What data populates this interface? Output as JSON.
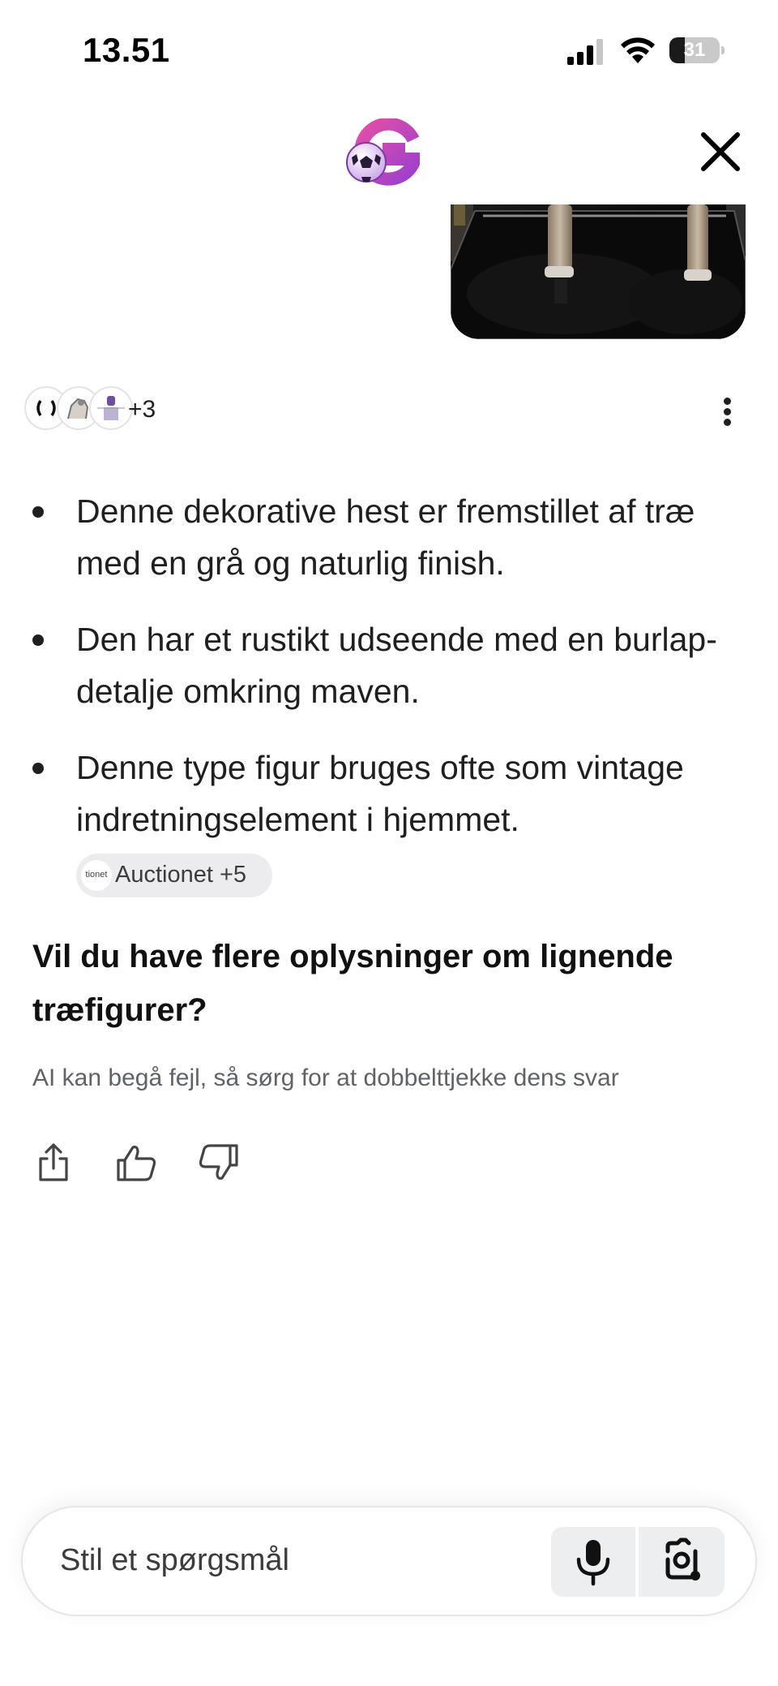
{
  "status_bar": {
    "time": "13.51",
    "battery_level": "31",
    "battery_fraction": 0.31
  },
  "header": {
    "logo_icon": "google-g-football-icon",
    "close_icon": "close-icon"
  },
  "sources": {
    "more_count": "+3"
  },
  "answer": {
    "bullets": [
      "Denne dekorative hest er fremstillet af træ med en grå og naturlig finish.",
      "Den har et rustikt udseende med en burlap-detalje omkring maven.",
      "Denne type figur bruges ofte som vintage indretningselement i hjemmet."
    ],
    "source_chip": "Auctionet +5",
    "source_chip_icon_text": "tionet",
    "follow_up": "Vil du have flere oplysninger om lignende træfigurer?",
    "disclaimer": "AI kan begå fejl, så sørg for at dobbelttjekke dens svar"
  },
  "input": {
    "placeholder": "Stil et spørgsmål"
  },
  "colors": {
    "text": "#1f1f1f",
    "muted": "#5f6368",
    "chip_bg": "#ececef",
    "logo_pink": "#c2399f"
  }
}
